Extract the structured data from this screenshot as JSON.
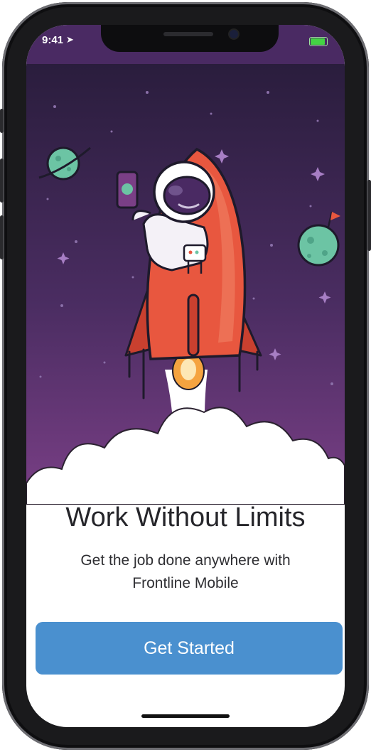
{
  "status_bar": {
    "time": "9:41",
    "location_icon": "location-arrow-icon",
    "battery_icon": "battery-icon",
    "battery_level": 0.9
  },
  "hero": {
    "illustration": "astronaut-rocket-illustration"
  },
  "onboarding": {
    "title": "Work Without Limits",
    "subtitle": "Get the job done anywhere with Frontline Mobile",
    "cta_label": "Get Started"
  },
  "colors": {
    "sky_top": "#2a1d3d",
    "sky_bottom": "#7a3f86",
    "rocket": "#e8573f",
    "button": "#4a90cf",
    "planet": "#6cc4a4"
  }
}
